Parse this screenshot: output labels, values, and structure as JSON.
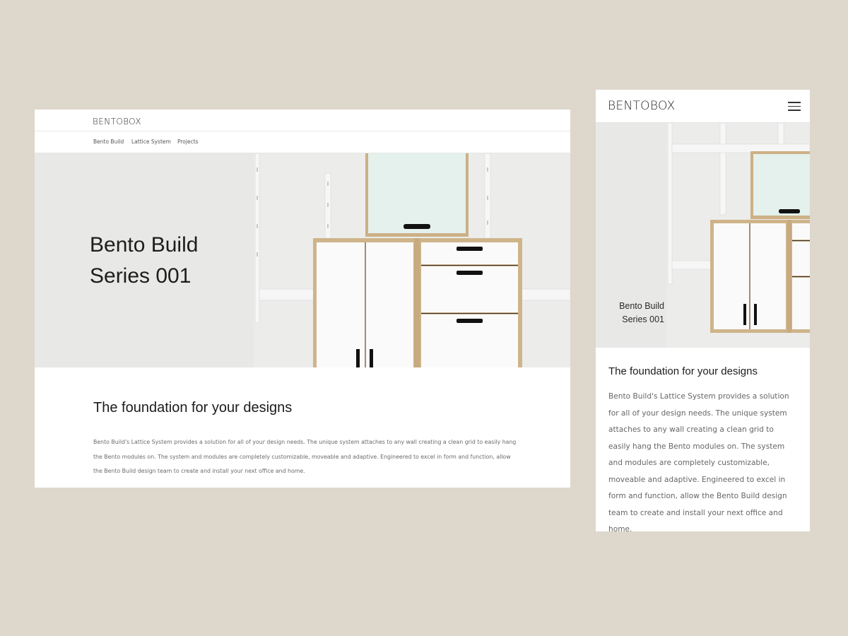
{
  "desktop": {
    "logo": "BENTOBOX",
    "nav": [
      {
        "label": "Bento Build"
      },
      {
        "label": "Lattice System"
      },
      {
        "label": "Projects"
      }
    ],
    "hero_title": "Bento Build Series 001",
    "heading": "The foundation for your designs",
    "body": "Bento Build's Lattice System provides a solution for all of your design needs. The unique system attaches to any wall creating a clean grid to easily hang the Bento modules on. The system and modules are completely customizable, moveable and adaptive. Engineered to excel in form and function, allow the Bento Build design team to create and install your next office and home."
  },
  "mobile": {
    "logo": "BENTOBOX",
    "menu_icon": "hamburger-menu-icon",
    "hero_title": "Bento Build Series 001",
    "heading": "The foundation for your designs",
    "body": "Bento Build's Lattice System provides a solution for all of your design needs. The unique system attaches to any wall creating a clean grid to easily hang the Bento modules on. The system and modules are completely customizable, moveable and adaptive. Engineered to excel in form and function, allow the Bento Build design team to create and install your next office and home."
  },
  "colors": {
    "page_background": "#ded7cc",
    "hero_background": "#e9e9e8",
    "wood": "#cfb48a",
    "cabinet_white": "#fafafa",
    "mint_panel": "#e4f1ec",
    "handle": "#111111"
  }
}
